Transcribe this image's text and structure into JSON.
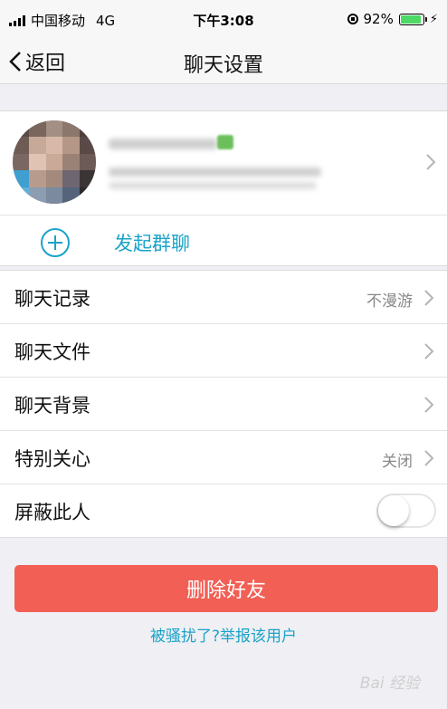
{
  "status_bar": {
    "carrier": "中国移动",
    "network": "4G",
    "time": "下午3:08",
    "battery": "92%",
    "battery_level": 0.92
  },
  "nav": {
    "back_label": "返回",
    "title": "聊天设置"
  },
  "profile": {
    "start_group_chat": "发起群聊"
  },
  "settings": [
    {
      "label": "聊天记录",
      "value": "不漫游"
    },
    {
      "label": "聊天文件",
      "value": ""
    },
    {
      "label": "聊天背景",
      "value": ""
    },
    {
      "label": "特别关心",
      "value": "关闭"
    },
    {
      "label": "屏蔽此人",
      "toggle": false
    }
  ],
  "delete_button": "删除好友",
  "report_link": "被骚扰了?举报该用户",
  "watermark": "Bai 经验",
  "colors": {
    "accent": "#1aa3c8",
    "delete": "#f25f55",
    "battery": "#4cd964"
  }
}
